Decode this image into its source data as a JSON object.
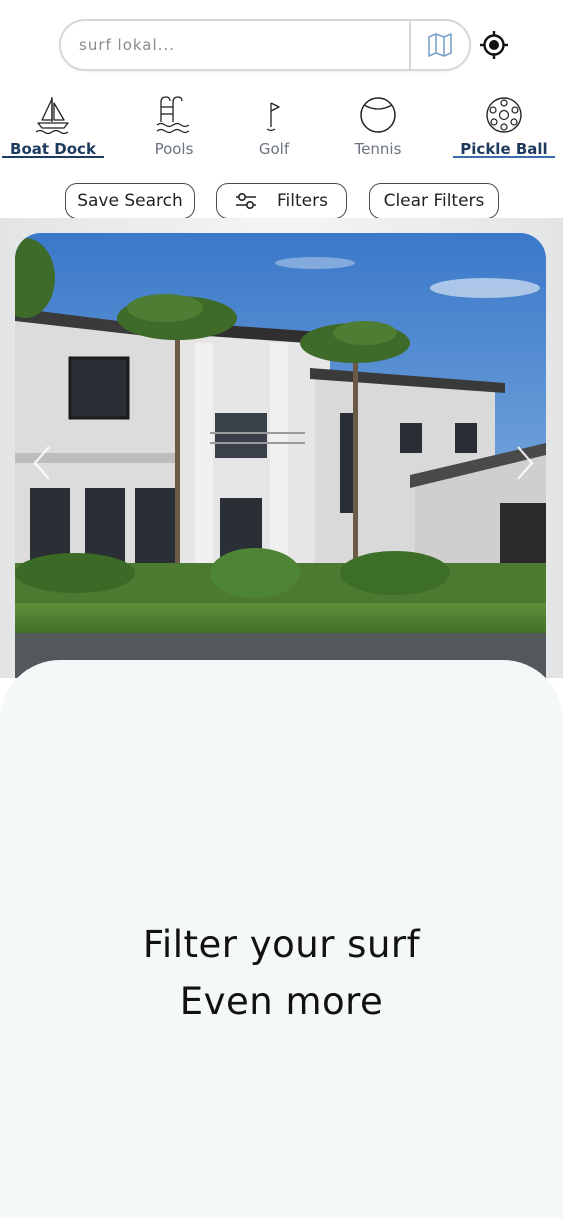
{
  "search": {
    "placeholder": "surf lokal...",
    "value": ""
  },
  "icons": {
    "map": "map-icon",
    "locate": "crosshair-icon"
  },
  "tabs": [
    {
      "label": "Boat Dock",
      "icon": "sailboat-icon",
      "active": true
    },
    {
      "label": "Pools",
      "icon": "pool-ladder-icon",
      "active": false
    },
    {
      "label": "Golf",
      "icon": "golf-flag-icon",
      "active": false
    },
    {
      "label": "Tennis",
      "icon": "tennis-ball-icon",
      "active": false
    },
    {
      "label": "Pickle Ball",
      "icon": "pickleball-icon",
      "active": true
    }
  ],
  "actions": {
    "save_search": "Save Search",
    "filters": "Filters",
    "clear_filters": "Clear Filters"
  },
  "carousel": {
    "prev_icon": "chevron-left-icon",
    "next_icon": "chevron-right-icon"
  },
  "sheet": {
    "line1": "Filter your surf",
    "line2": "Even more"
  },
  "colors": {
    "accent": "#1e3a5f",
    "underline": "#3b6ea8",
    "sheet_bg": "#f5f8f9",
    "map_icon": "#7aa3c9"
  }
}
